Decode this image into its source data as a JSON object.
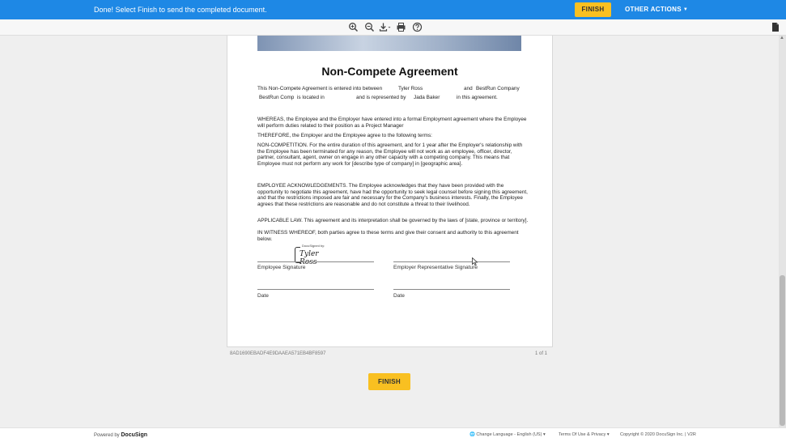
{
  "banner": {
    "message": "Done! Select Finish to send the completed document.",
    "finish_label": "FINISH",
    "other_actions_label": "OTHER ACTIONS",
    "color": "#1e88e5"
  },
  "toolbar": {
    "icons": [
      "zoom-in-icon",
      "zoom-out-icon",
      "download-icon",
      "print-icon",
      "help-icon"
    ]
  },
  "document": {
    "title": "Non-Compete Agreement",
    "line1_pre": "This Non-Compete Agreement is entered into between",
    "employee_name": "Tyler Ross",
    "and_word": "and",
    "employer_name": "BestRun Company",
    "employer_short": "BestRun Comp",
    "located_in": "is located in",
    "represented_by": "and is represented by",
    "representative_name": "Jada Baker",
    "in_this_agreement": "in this agreement.",
    "whereas": "WHEREAS, the Employee and the Employer have entered into a formal Employment agreement where the Employee will perform duties related to their position as a",
    "position": "Project Manager",
    "therefore": "THEREFORE, the Employer and the Employee agree to the following terms:",
    "non_competition": "NON-COMPETITION. For the entire duration of this agreement, and for 1 year after the Employer's relationship with the Employee has been terminated for any reason, the Employee will not work as an employee, officer, director, partner, consultant, agent, owner on engage in any other capacity with a competing company. This means that Employee must not perform any work for [describe type of company] in [geographic area].",
    "acknowledgements": "EMPLOYEE ACKNOWLEDGEMENTS. The Employee acknowledges that they have been provided with the opportunity to negotiate this agreement, have had the opportunity to seek legal counsel before signing this agreement, and that the restrictions imposed are fair and necessary for the Company's business interests. Finally, the Employee agrees that these restrictions are reasonable and do not constitute a threat to their livelihood.",
    "applicable_law": "APPLICABLE LAW. This agreement and its interpretation shall be governed by the laws of [state, province or territory].",
    "witness": "IN WITNESS WHEREOF, both parties agree to these terms and give their consent and authority to this agreement below.",
    "docusigned_by": "DocuSigned by:",
    "signature": "Tyler Ross",
    "employee_signature_label": "Employee Signature",
    "employer_signature_label": "Employer Representative Signature",
    "date_label_left": "Date",
    "date_label_right": "Date"
  },
  "doc_meta": {
    "envelope_id": "8AD1690EBADF4E9DAAEA571EB4BF8597",
    "page_count": "1 of 1"
  },
  "bottom": {
    "finish_label": "FINISH",
    "accent": "#f9c021"
  },
  "footer": {
    "powered_by": "Powered by",
    "brand": "DocuSign",
    "language": "Change Language - English (US)",
    "terms": "Terms Of Use & Privacy",
    "copyright": "Copyright © 2020 DocuSign Inc. | V2R"
  }
}
